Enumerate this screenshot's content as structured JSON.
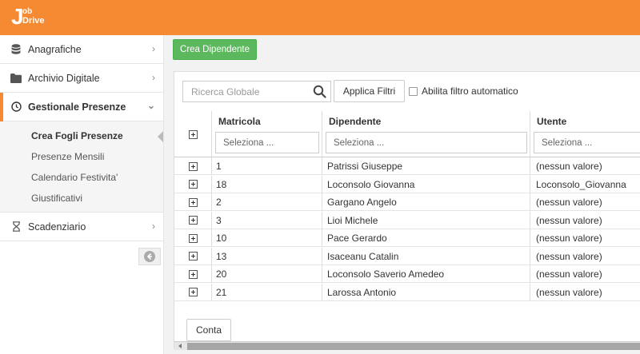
{
  "brand": {
    "letter": "J",
    "line1": "ob",
    "line2": "Drive"
  },
  "colors": {
    "accent": "#f68a33",
    "primary_button": "#5cb85c"
  },
  "sidebar": {
    "items": [
      {
        "label": "Anagrafiche",
        "icon": "database-icon"
      },
      {
        "label": "Archivio Digitale",
        "icon": "folder-icon"
      },
      {
        "label": "Gestionale Presenze",
        "icon": "clock-icon",
        "expanded": true
      },
      {
        "label": "Scadenziario",
        "icon": "hourglass-icon"
      }
    ],
    "submenu": [
      {
        "label": "Crea Fogli Presenze",
        "current": true
      },
      {
        "label": "Presenze Mensili"
      },
      {
        "label": "Calendario Festivita'"
      },
      {
        "label": "Giustificativi"
      }
    ]
  },
  "toolbar": {
    "create_label": "Crea Dipendente"
  },
  "filters": {
    "search_placeholder": "Ricerca Globale",
    "apply_label": "Applica Filtri",
    "auto_filter_label": "Abilita filtro automatico",
    "auto_filter_checked": false
  },
  "grid": {
    "columns": [
      {
        "title": "Matricola",
        "filter_placeholder": "Seleziona ..."
      },
      {
        "title": "Dipendente",
        "filter_placeholder": "Seleziona ..."
      },
      {
        "title": "Utente",
        "filter_placeholder": "Seleziona ..."
      }
    ],
    "rows": [
      [
        "1",
        "Patrissi Giuseppe",
        "(nessun valore)"
      ],
      [
        "18",
        "Loconsolo Giovanna",
        "Loconsolo_Giovanna"
      ],
      [
        "2",
        "Gargano Angelo",
        "(nessun valore)"
      ],
      [
        "3",
        "Lioi Michele",
        "(nessun valore)"
      ],
      [
        "10",
        "Pace Gerardo",
        "(nessun valore)"
      ],
      [
        "13",
        "Isaceanu Catalin",
        "(nessun valore)"
      ],
      [
        "20",
        "Loconsolo Saverio Amedeo",
        "(nessun valore)"
      ],
      [
        "21",
        "Larossa Antonio",
        "(nessun valore)"
      ]
    ]
  },
  "footer": {
    "count_label": "Conta"
  }
}
